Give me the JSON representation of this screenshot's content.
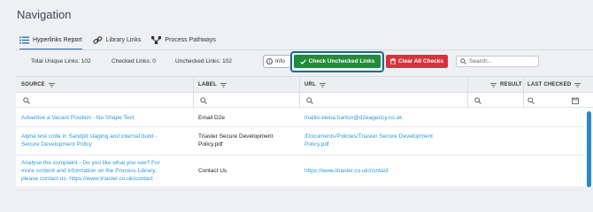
{
  "page_title": "Navigation",
  "tabs": [
    {
      "label": "Hyperlinks Report",
      "icon": "list-icon",
      "active": true
    },
    {
      "label": "Library Links",
      "icon": "link-icon",
      "active": false
    },
    {
      "label": "Process Pathways",
      "icon": "pathways-icon",
      "active": false
    }
  ],
  "stats": {
    "total": "Total Unique Links: 102",
    "checked": "Checked Links: 0",
    "unchecked": "Unchecked Links: 102"
  },
  "toolbar": {
    "info_label": "Info",
    "check_label": "Check Unchecked Links",
    "clear_label": "Clear All Checks",
    "search_placeholder": "Search...",
    "colors": {
      "check": "#1e8c3a",
      "clear": "#d7323d",
      "focus": "#176c8e"
    }
  },
  "columns": {
    "source": "SOURCE",
    "label": "LABEL",
    "url": "URL",
    "result": "RESULT",
    "last_checked": "LAST CHECKED"
  },
  "rows": [
    {
      "source": [
        "Advertise a Vacant Position - No Shape Text"
      ],
      "label": [
        "Email D2e"
      ],
      "url": [
        "mailto:elena.harton@d2eagency.co.uk"
      ]
    },
    {
      "source": [
        "Alpha test code in Sandpit staging and internal build -",
        "Secure Development Policy"
      ],
      "label": [
        "Triaster Secure Development",
        "Policy.pdf"
      ],
      "url": [
        "/Documents/Policies/Triaster Secure Development",
        "Policy.pdf"
      ]
    },
    {
      "source": [
        "Analyse the complaint - Do you like what you see? For",
        "more content and information on the Process Library,",
        "please contact us: https://www.triaster.co.uk/contact"
      ],
      "label": [
        "Contact Us"
      ],
      "url": [
        "https://www.triaster.co.uk/contact"
      ]
    }
  ]
}
